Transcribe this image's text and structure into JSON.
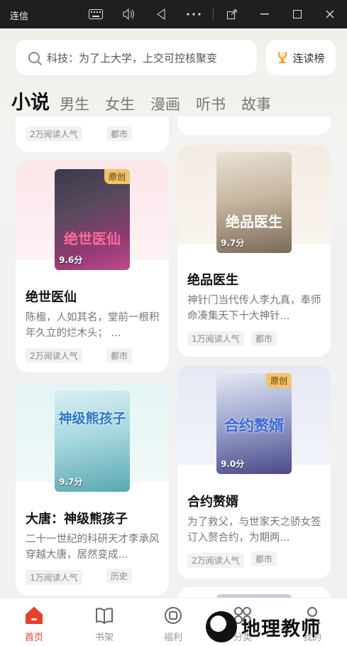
{
  "window": {
    "title": "连信",
    "icons": [
      "keyboard-icon",
      "volume-icon",
      "back-icon",
      "more-icon",
      "popout-icon",
      "minimize-icon",
      "maximize-icon",
      "close-icon"
    ]
  },
  "search": {
    "placeholder": "科技：为了上大学，上交可控核聚变"
  },
  "rank_button": {
    "label": "连读榜"
  },
  "tabs": [
    {
      "label": "小说",
      "active": true
    },
    {
      "label": "男生"
    },
    {
      "label": "女生"
    },
    {
      "label": "漫画"
    },
    {
      "label": "听书"
    },
    {
      "label": "故事"
    }
  ],
  "partial_card": {
    "popularity": "2万阅读人气",
    "category": "都市"
  },
  "books": [
    {
      "title": "绝世医仙",
      "cover_title": "绝世医仙",
      "score": "9.6分",
      "badge": "原创",
      "desc": "陈楹，人如其名，堂前一根积年久立的烂木头； ...",
      "popularity": "2万阅读人气",
      "category": "都市"
    },
    {
      "title": "绝品医生",
      "cover_title": "绝品医生",
      "score": "9.7分",
      "desc": "神针门当代传人李九真，奉师命凑集天下十大神针...",
      "popularity": "1万阅读人气",
      "category": "都市"
    },
    {
      "title": "大唐：神级熊孩子",
      "cover_title": "神级熊孩子",
      "score": "9.7分",
      "desc": "二十一世纪的科研天才李承风穿越大唐，居然变成...",
      "popularity": "1万阅读人气",
      "category": "历史"
    },
    {
      "title": "合约赘婿",
      "cover_title": "合约赘婿",
      "score": "9.0分",
      "badge": "原创",
      "desc": "为了救父，与世家天之骄女签订入赘合约，为期两...",
      "popularity": "2万阅读人气",
      "category": "都市"
    }
  ],
  "bottom_nav": [
    {
      "label": "首页",
      "icon": "home-icon",
      "active": true
    },
    {
      "label": "书架",
      "icon": "bookshelf-icon"
    },
    {
      "label": "福利",
      "icon": "welfare-icon"
    },
    {
      "label": "分类",
      "icon": "category-icon"
    },
    {
      "label": "我的",
      "icon": "profile-icon"
    }
  ],
  "watermark": {
    "text": "地理教师"
  },
  "colors": {
    "accent": "#e8402a",
    "badge": "#f2c46a"
  }
}
